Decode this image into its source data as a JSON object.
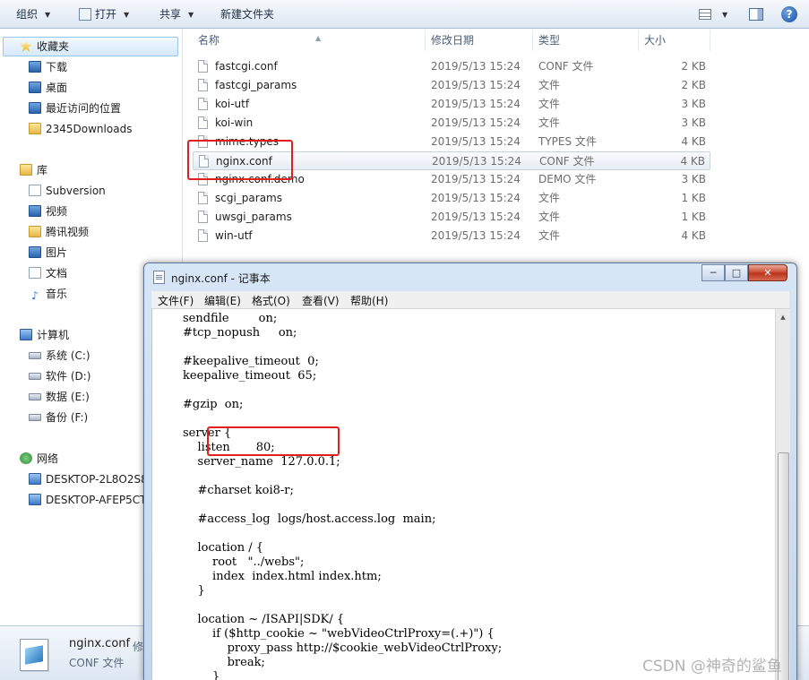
{
  "toolbar": {
    "organize": "组织",
    "open": "打开",
    "share": "共享",
    "new_folder": "新建文件夹",
    "help_glyph": "?"
  },
  "nav": {
    "favorites_header": "收藏夹",
    "favorites": [
      "下载",
      "桌面",
      "最近访问的位置",
      "2345Downloads"
    ],
    "library_header": "库",
    "libraries": [
      "Subversion",
      "视频",
      "腾讯视频",
      "图片",
      "文档",
      "音乐"
    ],
    "computer_header": "计算机",
    "drives": [
      "系统 (C:)",
      "软件 (D:)",
      "数据 (E:)",
      "备份 (F:)"
    ],
    "network_header": "网络",
    "network_items": [
      "DESKTOP-2L8O2S8",
      "DESKTOP-AFEP5CT"
    ]
  },
  "columns": {
    "name": "名称",
    "date": "修改日期",
    "type": "类型",
    "size": "大小"
  },
  "files": [
    {
      "name": "fastcgi.conf",
      "date": "2019/5/13 15:24",
      "type": "CONF 文件",
      "size": "2 KB"
    },
    {
      "name": "fastcgi_params",
      "date": "2019/5/13 15:24",
      "type": "文件",
      "size": "2 KB"
    },
    {
      "name": "koi-utf",
      "date": "2019/5/13 15:24",
      "type": "文件",
      "size": "3 KB"
    },
    {
      "name": "koi-win",
      "date": "2019/5/13 15:24",
      "type": "文件",
      "size": "3 KB"
    },
    {
      "name": "mime.types",
      "date": "2019/5/13 15:24",
      "type": "TYPES 文件",
      "size": "4 KB"
    },
    {
      "name": "nginx.conf",
      "date": "2019/5/13 15:24",
      "type": "CONF 文件",
      "size": "4 KB"
    },
    {
      "name": "nginx.conf.demo",
      "date": "2019/5/13 15:24",
      "type": "DEMO 文件",
      "size": "3 KB"
    },
    {
      "name": "scgi_params",
      "date": "2019/5/13 15:24",
      "type": "文件",
      "size": "1 KB"
    },
    {
      "name": "uwsgi_params",
      "date": "2019/5/13 15:24",
      "type": "文件",
      "size": "1 KB"
    },
    {
      "name": "win-utf",
      "date": "2019/5/13 15:24",
      "type": "文件",
      "size": "4 KB"
    }
  ],
  "details": {
    "name": "nginx.conf",
    "type": "CONF 文件",
    "modified_label": "修"
  },
  "notepad": {
    "title": "nginx.conf - 记事本",
    "minimize": "─",
    "maximize": "□",
    "close": "✕",
    "menu": [
      "文件(F)",
      "编辑(E)",
      "格式(O)",
      "查看(V)",
      "帮助(H)"
    ],
    "lines": [
      "sendfile        on;",
      "#tcp_nopush     on;",
      "",
      "#keepalive_timeout  0;",
      "keepalive_timeout  65;",
      "",
      "#gzip  on;",
      "",
      "server {",
      "    listen       80;",
      "    server_name  127.0.0.1;",
      "",
      "    #charset koi8-r;",
      "",
      "    #access_log  logs/host.access.log  main;",
      "",
      "    location / {",
      "        root   \"../webs\";",
      "        index  index.html index.htm;",
      "    }",
      "",
      "    location ~ /ISAPI|SDK/ {",
      "        if ($http_cookie ~ \"webVideoCtrlProxy=(.+)\") {",
      "            proxy_pass http://$cookie_webVideoCtrlProxy;",
      "            break;",
      "        }"
    ]
  },
  "watermark": "CSDN @神奇的鲨鱼",
  "colors": {
    "highlight_box": "#e01e1e",
    "selected_row_bg": "#e6ecf4",
    "toolbar_bg": "#dde7f3"
  }
}
